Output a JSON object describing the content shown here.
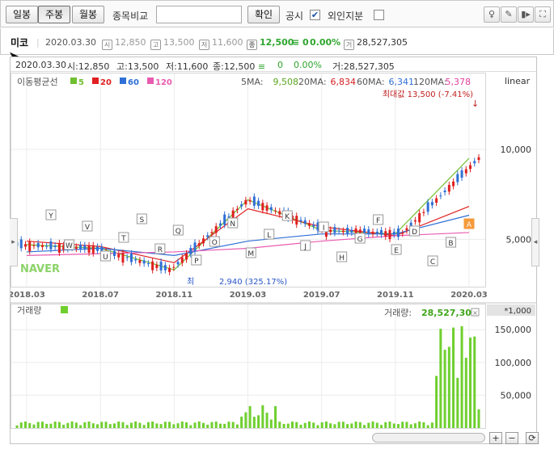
{
  "toolbar": {
    "daily": "일봉",
    "weekly": "주봉",
    "monthly": "월봉",
    "compare_label": "종목비교",
    "compare_value": "",
    "confirm": "확인",
    "disclosure": "공시",
    "disclosure_checked": "✔",
    "foreign": "외인지분",
    "tool_icons": [
      "tooltip-icon",
      "draw-icon",
      "toggle-icon",
      "fullscreen-icon"
    ]
  },
  "info": {
    "name": "미코",
    "date": "2020.03.30",
    "open_icon": "시",
    "open": "12,850",
    "high_icon": "고",
    "high": "13,500",
    "low_icon": "저",
    "low": "11,600",
    "close_icon": "종",
    "close": "12,500",
    "change": "≡ 0",
    "change_pct": "0.00%",
    "volume_icon": "거",
    "volume": "28,527,305",
    "up_color": "#e02020",
    "close_color": "#2ea52e"
  },
  "chart_head": {
    "date": "2020.03.30",
    "open_l": "시:",
    "open": "12,850",
    "high_l": "고:",
    "high": "13,500",
    "low_l": "저:",
    "low": "11,600",
    "close_l": "종:",
    "close": "12,500",
    "flat": "≡",
    "change": "0",
    "change_pct": "0.00%",
    "vol_l": "거:",
    "volume": "28,527,305"
  },
  "price_chart": {
    "ma_title": "이동평균선",
    "ma_legend": [
      {
        "label": "5",
        "color": "#6fbf2f"
      },
      {
        "label": "20",
        "color": "#e02020"
      },
      {
        "label": "60",
        "color": "#2f6fd6"
      },
      {
        "label": "120",
        "color": "#e85bb0"
      }
    ],
    "ma_values": [
      {
        "label": "5MA:",
        "value": "9,508",
        "color": "#5aa51f"
      },
      {
        "label": "20MA:",
        "value": "6,834",
        "color": "#d42020"
      },
      {
        "label": "60MA:",
        "value": "6,341",
        "color": "#2f6fd6"
      },
      {
        "label": "120MA:",
        "value": "5,378",
        "color": "#e040a0"
      }
    ],
    "scale": "linear",
    "y_ticks": [
      "10,000",
      "5,000"
    ],
    "x_ticks": [
      "2018.03",
      "2018.07",
      "2018.11",
      "2019.03",
      "2019.07",
      "2019.11",
      "2020.03"
    ],
    "max_label": "최대값 13,500 (-7.41%)",
    "min_label_prefix": "최",
    "min_label": "2,940 (325.17%)",
    "watermark": "NAVER",
    "event_markers": [
      "Y",
      "W",
      "V",
      "U",
      "T",
      "S",
      "R",
      "Q",
      "P",
      "O",
      "N",
      "M",
      "L",
      "K",
      "J",
      "I",
      "H",
      "G",
      "F",
      "E",
      "D",
      "C",
      "B",
      "A"
    ]
  },
  "volume_chart": {
    "title": "거래량",
    "legend_color": "#6fcf2f",
    "current_label": "거래량:",
    "current_value": "28,527,305",
    "unit": "*1,000",
    "y_ticks": [
      "150,000",
      "100,000",
      "50,000"
    ]
  },
  "chart_data": {
    "type": "line",
    "title": "",
    "xlabel": "",
    "ylabel": "",
    "x": [
      "2018.03",
      "2018.07",
      "2018.11",
      "2019.03",
      "2019.07",
      "2019.11",
      "2020.03"
    ],
    "series": [
      {
        "name": "5",
        "values": [
          4700,
          4500,
          3300,
          7200,
          5500,
          5300,
          9508
        ]
      },
      {
        "name": "20",
        "values": [
          4900,
          4600,
          3700,
          6700,
          5700,
          5200,
          6834
        ]
      },
      {
        "name": "60",
        "values": [
          4300,
          4500,
          4100,
          4900,
          5300,
          5300,
          6341
        ]
      },
      {
        "name": "120",
        "values": [
          4100,
          4200,
          4300,
          4500,
          4900,
          5200,
          5378
        ]
      }
    ],
    "ylim": [
      2500,
      14000
    ],
    "scale": "linear",
    "annotations": [
      "최대값 13,500 (-7.41%)",
      "2,940 (325.17%)"
    ],
    "volume": {
      "unit": "*1,000",
      "ylim": [
        0,
        170000
      ],
      "last": 28527
    }
  }
}
